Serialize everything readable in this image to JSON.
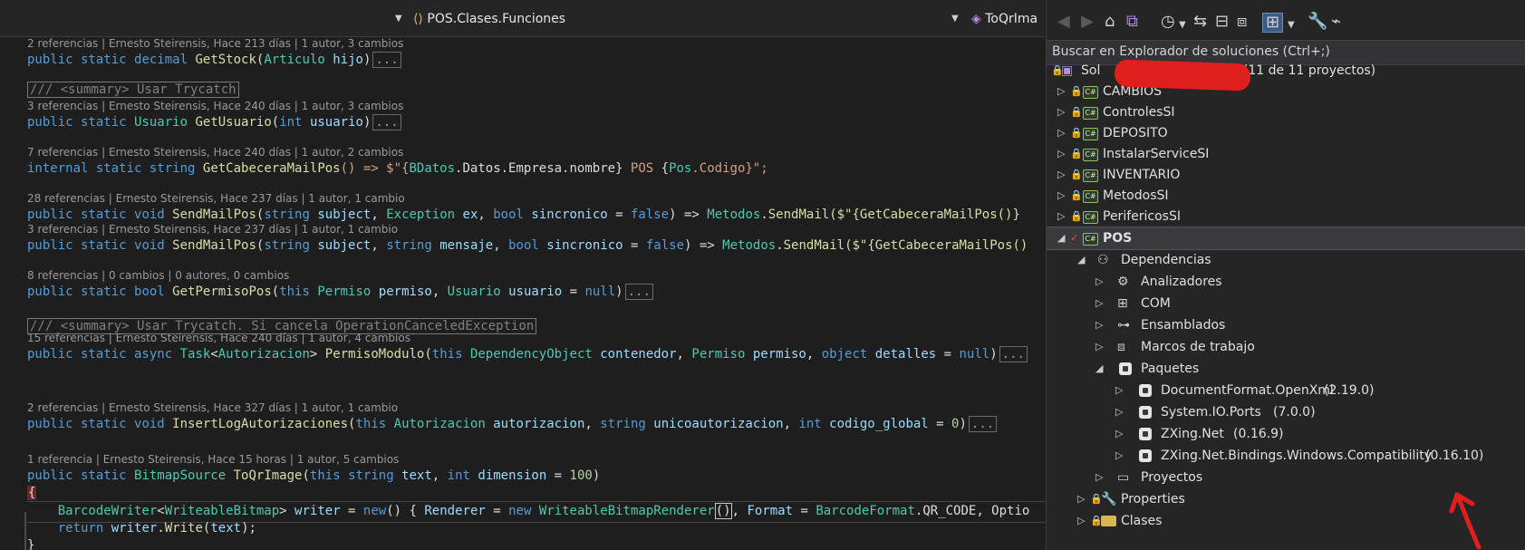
{
  "editor": {
    "nav": {
      "member_scope": "POS.Clases.Funciones",
      "method_scope": "ToQrIma"
    },
    "lines": [
      {
        "lens": "2 referencias | Ernesto Steirensis, Hace 213 días | 1 autor, 3 cambios",
        "code": {
          "kw": "public static",
          "kw2": "decimal",
          "fn": "GetStock",
          "p1": "(",
          "ty": "Articulo",
          "pr": "hijo",
          "p2": ")",
          "fold": "..."
        }
      },
      {
        "summary": "/// <summary> Usar Trycatch",
        "lens": "3 referencias | Ernesto Steirensis, Hace 240 días | 1 autor, 3 cambios",
        "code": {
          "kw": "public static",
          "ty": "Usuario",
          "fn": "GetUsuario",
          "p1": "(",
          "kw2": "int",
          "pr": "usuario",
          "p2": ")",
          "fold": "..."
        }
      },
      {
        "lens": "7 referencias | Ernesto Steirensis, Hace 240 días | 1 autor, 2 cambios",
        "code": {
          "kw": "internal static",
          "kw2": "string",
          "fn": "GetCabeceraMailPos",
          "rest1": "() => $\"{",
          "ty": "BDatos",
          "rest2": ".Datos.Empresa.nombre} ",
          "st": "POS",
          "rest3": " {",
          "ty2": "Pos",
          "rest4": ".Codigo}\";"
        }
      },
      {
        "lens": "28 referencias | Ernesto Steirensis, Hace 237 días | 1 autor, 1 cambio",
        "code": {
          "kw": "public static",
          "kw2": "void",
          "fn": "SendMailPos",
          "p1": "(",
          "kw3": "string",
          "pr": "subject",
          "c1": ", ",
          "ty": "Exception",
          "pr2": "ex",
          "c2": ", ",
          "kw4": "bool",
          "pr3": "sincronico",
          "eq": " = ",
          "kw5": "false",
          "arrow": ") => ",
          "ty2": "Metodos",
          "dot": ".",
          "fn2": "SendMail",
          "tail": "($\"{GetCabeceraMailPos()}"
        }
      },
      {
        "lens": "3 referencias | Ernesto Steirensis, Hace 237 días | 1 autor, 1 cambio",
        "code": {
          "kw": "public static",
          "kw2": "void",
          "fn": "SendMailPos",
          "p1": "(",
          "kw3": "string",
          "pr": "subject",
          "c1": ", ",
          "kw4": "string",
          "pr2": "mensaje",
          "c2": ", ",
          "kw5": "bool",
          "pr3": "sincronico",
          "eq": " = ",
          "kw6": "false",
          "arrow": ") => ",
          "ty2": "Metodos",
          "dot": ".",
          "fn2": "SendMail",
          "tail": "($\"{GetCabeceraMailPos()"
        }
      },
      {
        "lens": "8 referencias | 0 cambios | 0 autores, 0 cambios",
        "code": {
          "kw": "public static",
          "kw2": "bool",
          "fn": "GetPermisoPos",
          "p1": "(",
          "kw3": "this",
          "ty": "Permiso",
          "pr": "permiso",
          "c1": ", ",
          "ty2": "Usuario",
          "pr2": "usuario",
          "eq": " = ",
          "kw4": "null",
          "p2": ")",
          "fold": "..."
        }
      },
      {
        "summary": "/// <summary> Usar Trycatch. Si cancela OperationCanceledException",
        "lens": "15 referencias | Ernesto Steirensis, Hace 240 días | 1 autor, 4 cambios",
        "code": {
          "kw": "public static async",
          "ty": "Task",
          "lt": "<",
          "ty2": "Autorizacion",
          "gt": ">",
          "fn": "PermisoModulo",
          "p1": "(",
          "kw2": "this",
          "ty3": "DependencyObject",
          "pr": "contenedor",
          "c1": ", ",
          "ty4": "Permiso",
          "pr2": "permiso",
          "c2": ", ",
          "kw3": "object",
          "pr3": "detalles",
          "eq": " = ",
          "kw4": "null",
          "p2": ")",
          "fold": "..."
        }
      },
      {
        "lens": "2 referencias | Ernesto Steirensis, Hace 327 días | 1 autor, 1 cambio",
        "code": {
          "kw": "public static",
          "kw2": "void",
          "fn": "InsertLogAutorizaciones",
          "p1": "(",
          "kw3": "this",
          "ty": "Autorizacion",
          "pr": "autorizacion",
          "c1": ", ",
          "kw4": "string",
          "pr2": "unicoautorizacion",
          "c2": ", ",
          "kw5": "int",
          "pr3": "codigo_global",
          "eq": " = ",
          "nm": "0",
          "p2": ")",
          "fold": "..."
        }
      },
      {
        "lens": "1 referencia | Ernesto Steirensis, Hace 15 horas | 1 autor, 5 cambios",
        "code": {
          "kw": "public static",
          "ty": "BitmapSource",
          "fn": "ToQrImage",
          "p1": "(",
          "kw2": "this",
          "kw3": "string",
          "pr": "text",
          "c1": ", ",
          "kw4": "int",
          "pr2": "dimension",
          "eq": " = ",
          "nm": "100",
          "p2": ")"
        }
      }
    ],
    "body": {
      "open_brace": "{",
      "l1": {
        "ty": "BarcodeWriter",
        "lt": "<",
        "ty2": "WriteableBitmap",
        "gt": ">",
        "pr": "writer",
        "eq": " = ",
        "kw": "new",
        "mid": "() { ",
        "pr2": "Renderer",
        "eq2": " = ",
        "kw2": "new",
        "ty3": "WriteableBitmapRenderer",
        "cp": "()",
        "rest": ", ",
        "pr3": "Format",
        "eq3": " = ",
        "ty4": "BarcodeFormat",
        "tail": ".QR_CODE, Optio"
      },
      "l2": {
        "kw": "return",
        "pr": "writer",
        "dot": ".",
        "fn": "Write",
        "p1": "(",
        "pr2": "text",
        "p2": ");"
      },
      "close_brace": "}"
    }
  },
  "solution_explorer": {
    "search_placeholder": "Buscar en Explorador de soluciones (Ctrl+;)",
    "solution_label": "Sol",
    "solution_suffix": "\"  (11 de 11 proyectos)",
    "projects": [
      "CAMBIOS",
      "ControlesSI",
      "DEPOSITO",
      "InstalarServiceSI",
      "INVENTARIO",
      "MetodosSI",
      "PerifericosSI"
    ],
    "selected_project": "POS",
    "dependencies": "Dependencias",
    "dep_items": [
      "Analizadores",
      "COM",
      "Ensamblados",
      "Marcos de trabajo"
    ],
    "packages_label": "Paquetes",
    "packages": [
      {
        "name": "DocumentFormat.OpenXml",
        "version": "(2.19.0)"
      },
      {
        "name": "System.IO.Ports",
        "version": "(7.0.0)"
      },
      {
        "name": "ZXing.Net",
        "version": "(0.16.9)"
      },
      {
        "name": "ZXing.Net.Bindings.Windows.Compatibility",
        "version": "(0.16.10)"
      }
    ],
    "projects_ref": "Proyectos",
    "folders": [
      "Properties",
      "Clases"
    ],
    "icon_cs": "C#"
  },
  "colors": {
    "keyword": "#569cd6",
    "type": "#4ec9b0",
    "method": "#dcdcaa",
    "param": "#9cdcfe",
    "annotation": "#e11e1e"
  }
}
